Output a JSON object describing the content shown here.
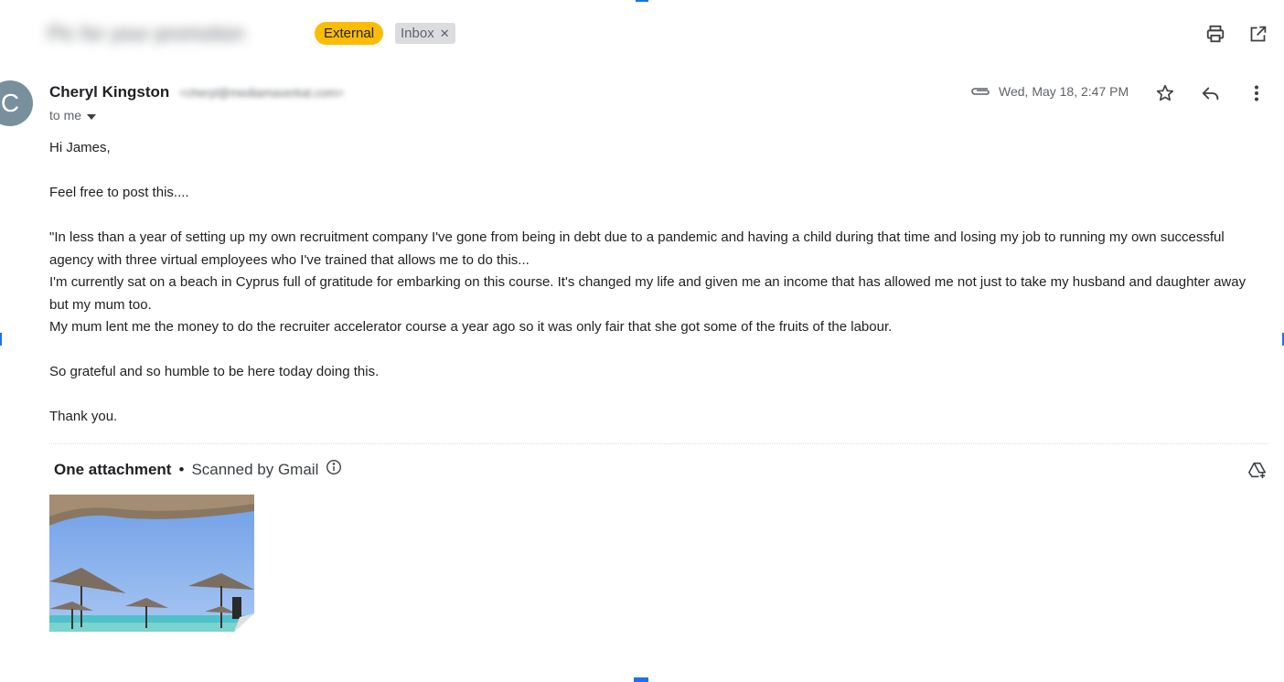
{
  "subject": "Pic for your promotion",
  "labels": {
    "external": "External",
    "inbox": "Inbox"
  },
  "message": {
    "avatar_initial": "C",
    "sender_name": "Cheryl Kingston",
    "sender_email": "<cheryl@mediamaverkat.com>",
    "recipient": "to me",
    "date": "Wed, May 18, 2:47 PM",
    "body": {
      "greeting": "Hi James,",
      "line1": "Feel free to post this....",
      "para1": "\"In less than a year of setting up my own recruitment company I've gone from being in debt due to a pandemic and having a child during that time and losing my job to running my own successful agency with three virtual employees who I've trained that allows me to do this...",
      "para2": "I'm currently sat on a beach in Cyprus full of gratitude for embarking on this course. It's changed my life and given me an income that has allowed me not just to take my husband and daughter away but my mum too.",
      "para3": "My mum lent me the money to do the recruiter accelerator course a year ago so it was only fair that she got some of the fruits of the labour.",
      "para4": "So grateful and so humble to be here today doing this.",
      "closing": "Thank you."
    }
  },
  "attachments": {
    "count_label": "One attachment",
    "separator": "•",
    "scan_label": "Scanned by Gmail"
  },
  "icons": {
    "print": "print-icon",
    "open_new_window": "open-in-new-window-icon",
    "attachment": "paperclip-icon",
    "star": "star-icon",
    "reply": "reply-icon",
    "more": "more-vert-icon",
    "info": "info-icon",
    "add_to_drive": "add-to-drive-icon",
    "dropdown": "arrow-drop-down-icon",
    "remove_label": "close-icon"
  },
  "colors": {
    "external_chip": "#fbbc04",
    "inbox_chip": "#dadce0",
    "avatar": "#78909c",
    "text_secondary": "#5f6368"
  }
}
